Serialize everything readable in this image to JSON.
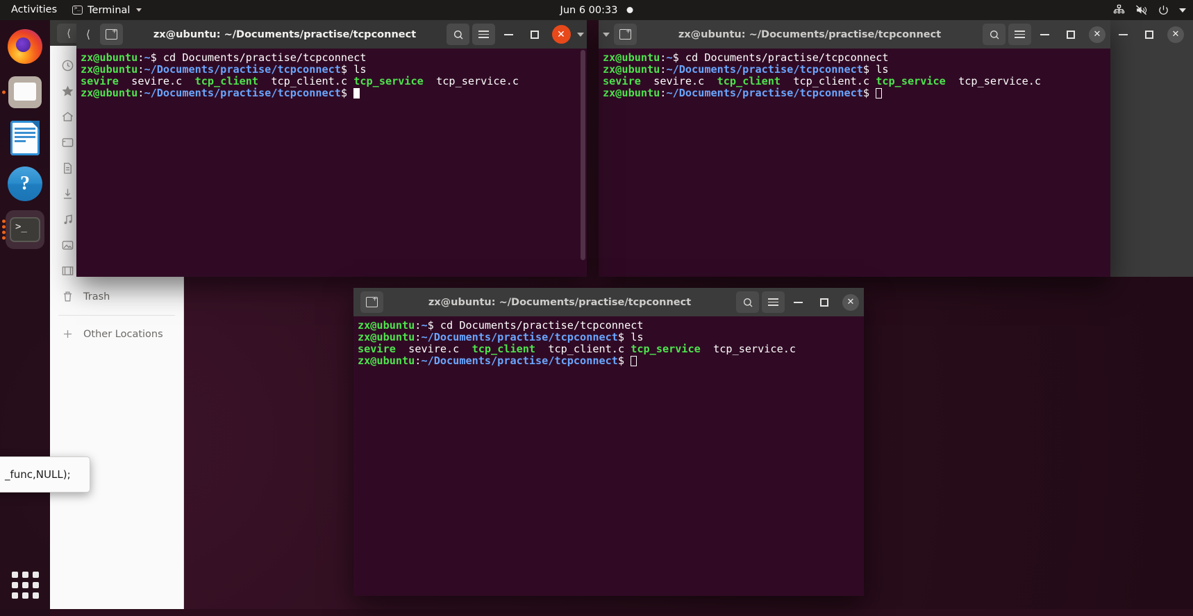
{
  "topbar": {
    "activities": "Activities",
    "app_name": "Terminal",
    "app_icon": "terminal-icon",
    "clock": "Jun 6  00:33",
    "recording_indicator": "recording-dot",
    "tray": [
      "network-icon",
      "volume-muted-icon",
      "power-icon",
      "chevron-down-icon"
    ]
  },
  "dock": {
    "items": [
      {
        "name": "firefox",
        "label": "Firefox"
      },
      {
        "name": "files",
        "label": "Files"
      },
      {
        "name": "libreoffice-impress",
        "label": "LibreOffice Impress"
      },
      {
        "name": "help",
        "label": "Help"
      },
      {
        "name": "terminal",
        "label": "Terminal",
        "running_dots": 4,
        "active": true
      }
    ],
    "show_apps": "show-applications-grid"
  },
  "files_window": {
    "sidebar": [
      {
        "icon": "recent-icon",
        "label": ""
      },
      {
        "icon": "starred-icon",
        "label": ""
      },
      {
        "icon": "home-icon",
        "label": ""
      },
      {
        "icon": "desktop-icon",
        "label": ""
      },
      {
        "icon": "documents-icon",
        "label": ""
      },
      {
        "icon": "downloads-icon",
        "label": ""
      },
      {
        "icon": "music-icon",
        "label": ""
      },
      {
        "icon": "pictures-icon",
        "label": ""
      },
      {
        "icon": "videos-icon",
        "label": "Videos"
      },
      {
        "icon": "trash-icon",
        "label": "Trash"
      },
      {
        "icon": "plus-icon",
        "label": "Other Locations"
      }
    ]
  },
  "terminal_title": "zx@ubuntu: ~/Documents/practise/tcpconnect",
  "terminal_lines": {
    "l1_prompt_user": "zx@ubuntu",
    "l1_colon": ":",
    "l1_path": "~",
    "l1_dollar": "$ ",
    "l1_cmd": "cd Documents/practise/tcpconnect",
    "l2_prompt_user": "zx@ubuntu",
    "l2_colon": ":",
    "l2_path": "~/Documents/practise/tcpconnect",
    "l2_dollar": "$ ",
    "l2_cmd": "ls",
    "l3_f1": "sevire",
    "l3_f2": "sevire.c",
    "l3_f3": "tcp_client",
    "l3_f4": "tcp_client.c",
    "l3_f5": "tcp_service",
    "l3_f6": "tcp_service.c",
    "l4_prompt_user": "zx@ubuntu",
    "l4_colon": ":",
    "l4_path": "~/Documents/practise/tcpconnect",
    "l4_dollar": "$ "
  },
  "windows": [
    {
      "id": "win1",
      "title": "zx@ubuntu: ~/Documents/practise/tcpconnect",
      "focused": true,
      "close_style": "orange-circle"
    },
    {
      "id": "win2",
      "title": "zx@ubuntu: ~/Documents/practise/tcpconnect",
      "focused": false,
      "close_style": "grey-circle"
    },
    {
      "id": "win3",
      "title": "zx@ubuntu: ~/Documents/practise/tcpconnect",
      "focused": false,
      "close_style": "grey-circle"
    }
  ],
  "titlebar_buttons": {
    "new_tab": "new-tab-icon",
    "search": "search-icon",
    "menu": "hamburger-menu-icon",
    "minimize": "minimize-button",
    "maximize": "maximize-button",
    "close": "close-button",
    "back": "back-arrow"
  },
  "popup": {
    "text": "_func,NULL);"
  },
  "colors": {
    "terminal_bg": "#300a24",
    "prompt_green": "#4ee44e",
    "path_blue": "#6aa6ff",
    "close_orange": "#e8491b",
    "topbar_bg": "#1d1b1a",
    "titlebar_bg": "#353535"
  }
}
